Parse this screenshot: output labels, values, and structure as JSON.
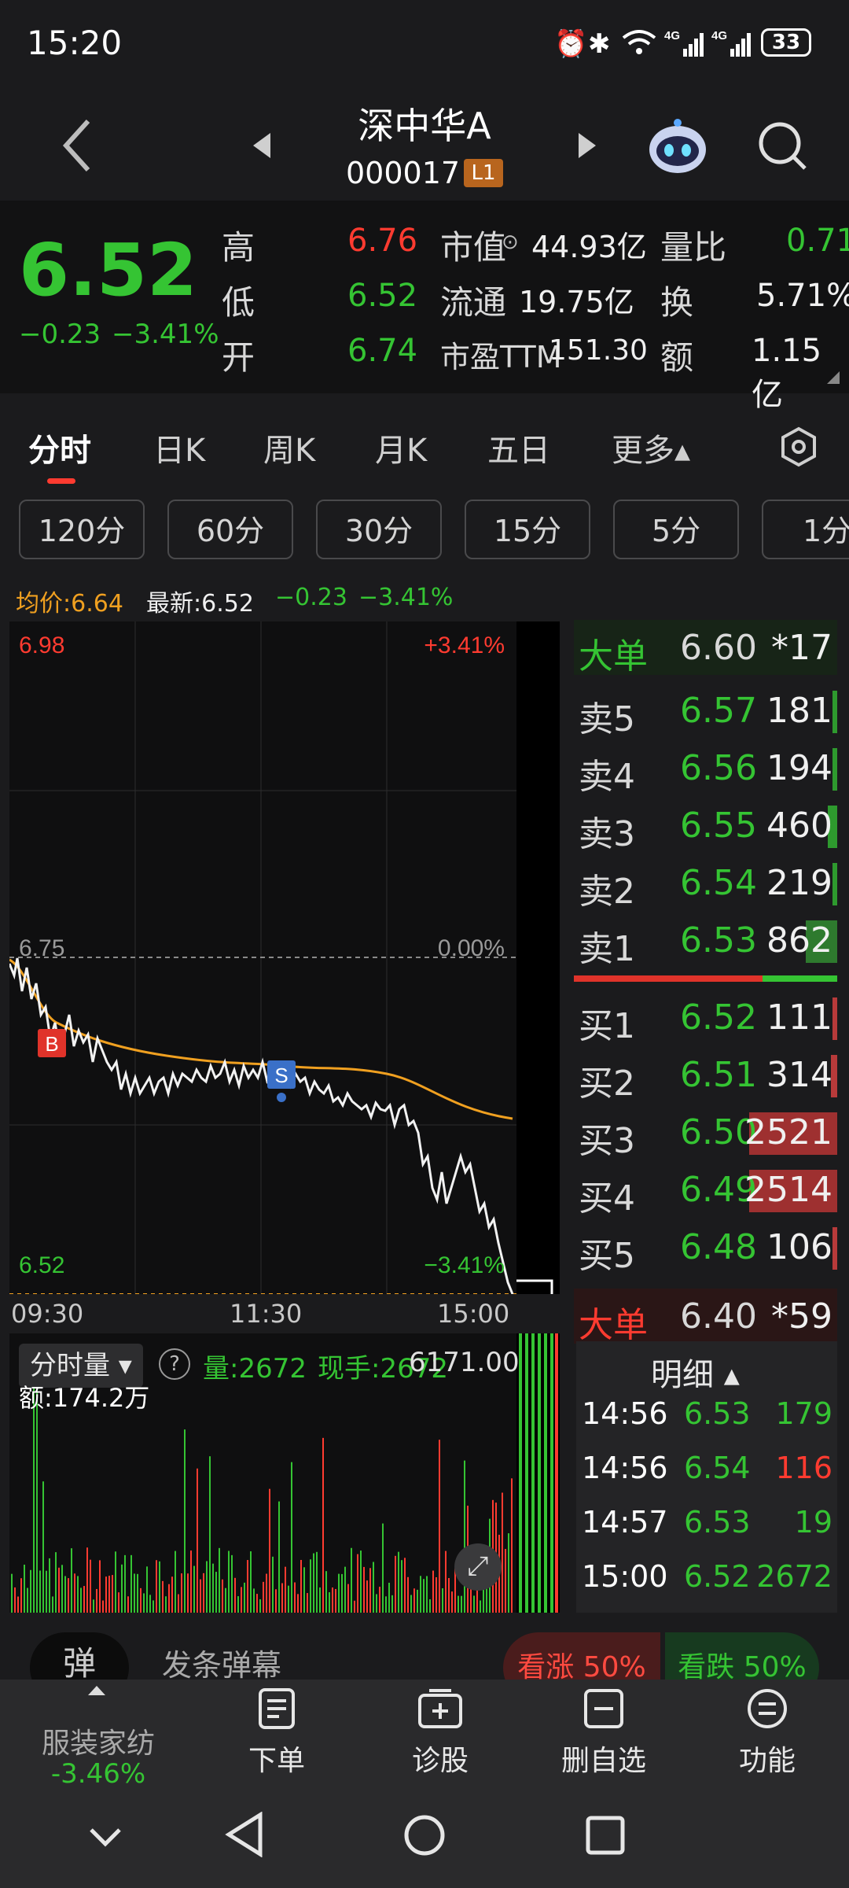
{
  "status_bar": {
    "time": "15:20",
    "battery": "33"
  },
  "header": {
    "name": "深中华A",
    "code": "000017",
    "level_badge": "L1"
  },
  "quote": {
    "price": "6.52",
    "change": "−0.23",
    "change_pct": "−3.41%",
    "high_label": "高",
    "high": "6.76",
    "low_label": "低",
    "low": "6.52",
    "open_label": "开",
    "open": "6.74",
    "mktcap_label": "市值",
    "mktcap": "44.93亿",
    "float_label": "流通",
    "float": "19.75亿",
    "pe_label": "市盈TTM",
    "pe": "151.30",
    "vr_label": "量比",
    "vr": "0.71",
    "turn_label": "换",
    "turn": "5.71%",
    "amt_label": "额",
    "amt": "1.15亿"
  },
  "tabs": [
    "分时",
    "日K",
    "周K",
    "月K",
    "五日",
    "更多▴"
  ],
  "periods": [
    "120分",
    "60分",
    "30分",
    "15分",
    "5分",
    "1分"
  ],
  "info_line": {
    "avg": "均价:6.64",
    "latest": "最新:6.52",
    "chg": "−0.23",
    "pct": "−3.41%"
  },
  "chart": {
    "y_top": "6.98",
    "y_top_pct": "+3.41%",
    "y_mid": "6.75",
    "y_mid_pct": "0.00%",
    "y_bot": "6.52",
    "y_bot_pct": "−3.41%",
    "x_labels": [
      "09:30",
      "11:30",
      "15:00"
    ],
    "buy_marker": "B",
    "sell_marker": "S",
    "vol_label": "分时量 ▾",
    "vol": "量:2672",
    "cur_hand": "现手:2672",
    "vol_max": "6171.00",
    "amount": "额:174.2万"
  },
  "orderbook": {
    "big_sell": {
      "label": "大单",
      "price": "6.60",
      "vol": "*17"
    },
    "asks": [
      {
        "label": "卖5",
        "price": "6.57",
        "vol": "181"
      },
      {
        "label": "卖4",
        "price": "6.56",
        "vol": "194"
      },
      {
        "label": "卖3",
        "price": "6.55",
        "vol": "460"
      },
      {
        "label": "卖2",
        "price": "6.54",
        "vol": "219"
      },
      {
        "label": "卖1",
        "price": "6.53",
        "vol": "862"
      }
    ],
    "bids": [
      {
        "label": "买1",
        "price": "6.52",
        "vol": "111"
      },
      {
        "label": "买2",
        "price": "6.51",
        "vol": "314"
      },
      {
        "label": "买3",
        "price": "6.50",
        "vol": "2521"
      },
      {
        "label": "买4",
        "price": "6.49",
        "vol": "2514"
      },
      {
        "label": "买5",
        "price": "6.48",
        "vol": "106"
      }
    ],
    "big_buy": {
      "label": "大单",
      "price": "6.40",
      "vol": "*59"
    }
  },
  "detail": {
    "title": "明细 ▴",
    "rows": [
      {
        "time": "14:56",
        "price": "6.53",
        "vol": "179"
      },
      {
        "time": "14:56",
        "price": "6.54",
        "vol": "116"
      },
      {
        "time": "14:57",
        "price": "6.53",
        "vol": "19"
      },
      {
        "time": "15:00",
        "price": "6.52",
        "vol": "2672"
      }
    ]
  },
  "danmu": {
    "badge": "弹",
    "placeholder": "发条弹幕",
    "up": "看涨 50%",
    "down": "看跌 50%"
  },
  "bottom_nav": {
    "sector": "服装家纺",
    "sector_pct": "-3.46%",
    "order": "下单",
    "diagnose": "诊股",
    "remove_fav": "删自选",
    "function": "功能"
  },
  "colors": {
    "up": "#ff3b30",
    "down": "#35c433",
    "avg_line": "#f0a020",
    "bg": "#1b1b1d"
  }
}
